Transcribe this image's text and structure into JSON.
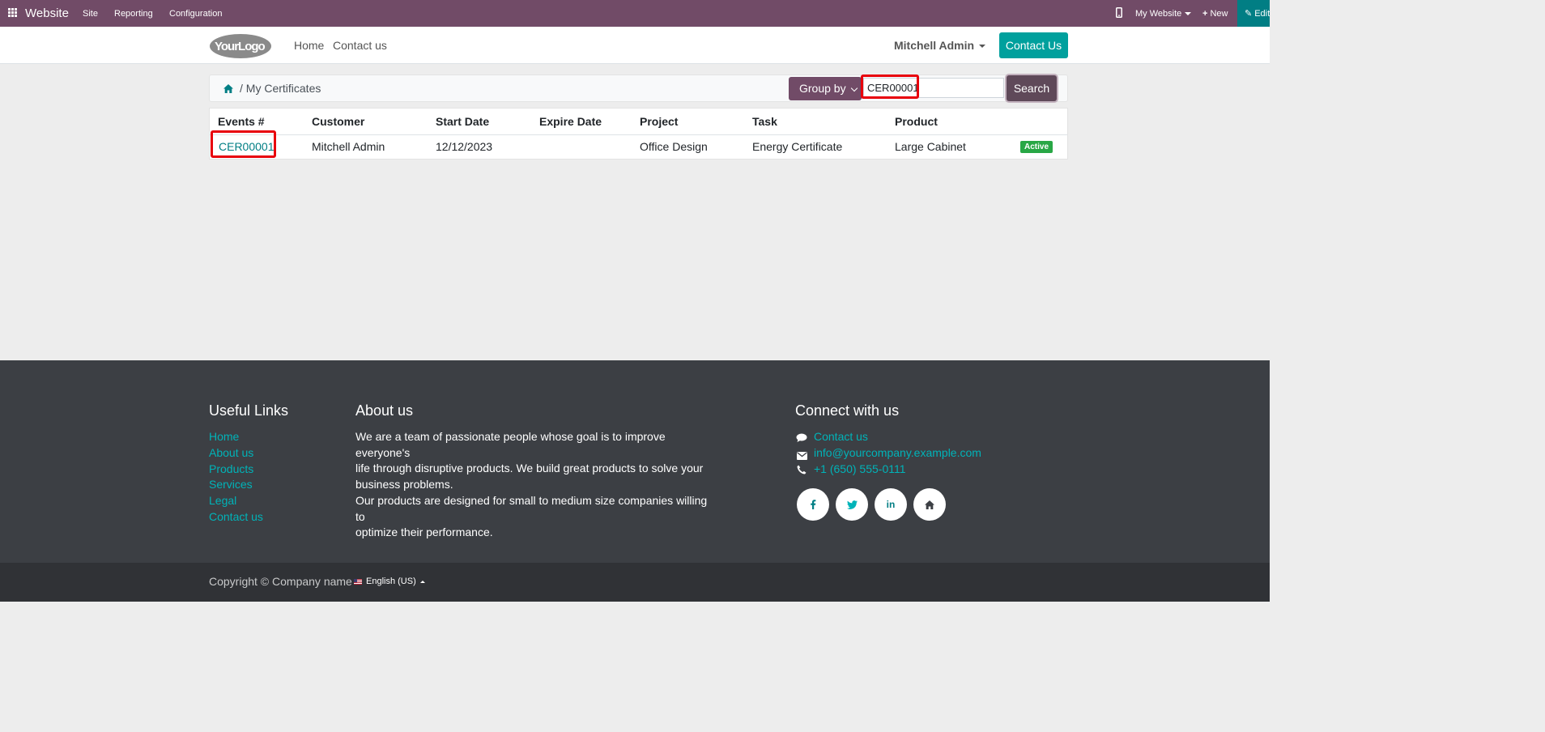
{
  "admin": {
    "brand": "Website",
    "menu": [
      "Site",
      "Reporting",
      "Configuration"
    ],
    "website_selector": "My Website",
    "new_label": "New",
    "edit_label": "Edit"
  },
  "header": {
    "logo_text": "YourLogo",
    "nav": [
      "Home",
      "Contact us"
    ],
    "user": "Mitchell Admin",
    "contact_button": "Contact Us"
  },
  "breadcrumb": {
    "current": "/ My Certificates"
  },
  "search": {
    "group_by_label": "Group by",
    "value": "CER00001",
    "button_label": "Search"
  },
  "table": {
    "columns": [
      "Events #",
      "Customer",
      "Start Date",
      "Expire Date",
      "Project",
      "Task",
      "Product"
    ],
    "rows": [
      {
        "event": "CER00001",
        "customer": "Mitchell Admin",
        "start_date": "12/12/2023",
        "expire_date": "",
        "project": "Office Design",
        "task": "Energy Certificate",
        "product": "Large Cabinet",
        "status": "Active"
      }
    ]
  },
  "footer": {
    "useful_links_title": "Useful Links",
    "useful_links": [
      "Home",
      "About us",
      "Products",
      "Services",
      "Legal",
      "Contact us"
    ],
    "about_title": "About us",
    "about_lines_1": [
      "We are a team of passionate people whose goal is to improve everyone's",
      "life through disruptive products. We build great products to solve your",
      "business problems."
    ],
    "about_lines_2": [
      "Our products are designed for small to medium size companies willing to",
      "optimize their performance."
    ],
    "connect_title": "Connect with us",
    "contact_link": "Contact us",
    "email": "info@yourcompany.example.com",
    "phone": "+1 (650) 555-0111",
    "social": [
      "facebook-icon",
      "twitter-icon",
      "linkedin-icon",
      "home-icon"
    ],
    "copyright": "Copyright © Company name",
    "language": "English (US)"
  },
  "colors": {
    "admin_bar": "#714b67",
    "accent": "#00a09d",
    "link": "#017e84",
    "highlight": "#e8000b",
    "badge_active": "#28a745",
    "footer_bg": "#3c3f44"
  }
}
